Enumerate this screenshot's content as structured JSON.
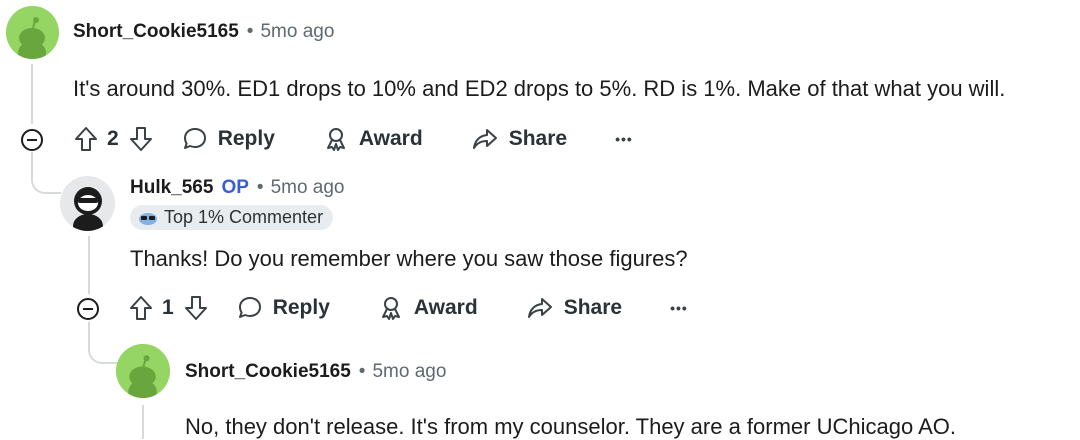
{
  "comments": [
    {
      "username": "Short_Cookie5165",
      "separator": "•",
      "time": "5mo ago",
      "text": "It's around 30%. ED1 drops to 10% and ED2 drops to 5%. RD is 1%. Make of that what you will.",
      "votes": "2",
      "actions": {
        "reply": "Reply",
        "award": "Award",
        "share": "Share",
        "more": "•••"
      },
      "avatar_color": "#94d564"
    },
    {
      "username": "Hulk_565",
      "op_badge": "OP",
      "separator": "•",
      "time": "5mo ago",
      "flair": "Top 1% Commenter",
      "text": "Thanks! Do you remember where you saw those figures?",
      "votes": "1",
      "actions": {
        "reply": "Reply",
        "award": "Award",
        "share": "Share",
        "more": "•••"
      }
    },
    {
      "username": "Short_Cookie5165",
      "separator": "•",
      "time": "5mo ago",
      "text": "No, they don't release. It's from my counselor. They are a former UChicago AO.",
      "avatar_color": "#94d564"
    }
  ],
  "colors": {
    "op": "#3b5fd1",
    "thread": "#d7dadc",
    "muted": "#5f6a70"
  }
}
